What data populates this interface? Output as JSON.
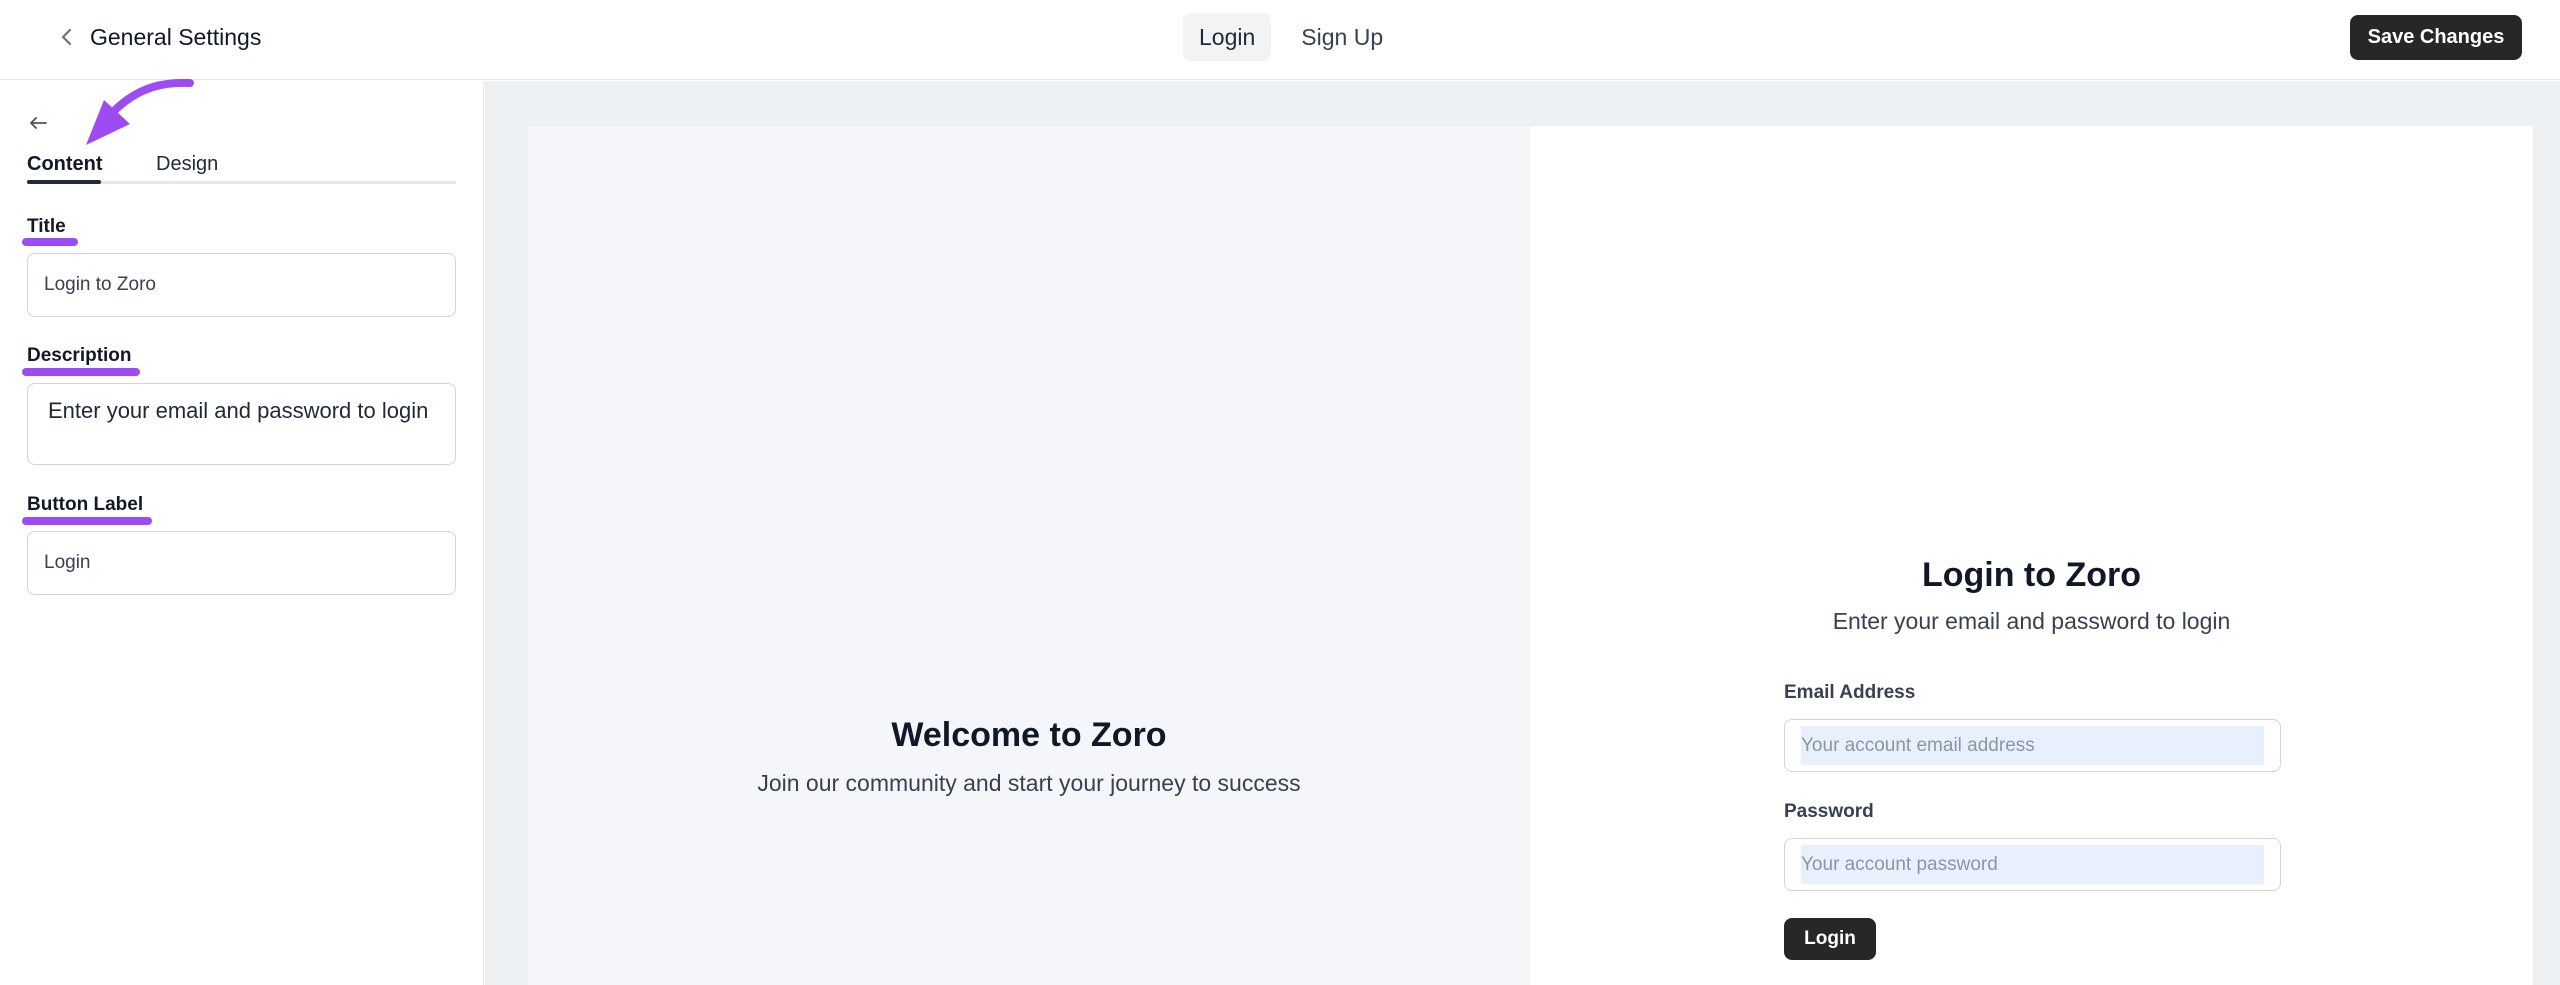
{
  "header": {
    "title": "General Settings",
    "mode_tabs": [
      {
        "label": "Login",
        "active": true
      },
      {
        "label": "Sign Up",
        "active": false
      }
    ],
    "save_label": "Save Changes"
  },
  "sidebar": {
    "tabs": [
      {
        "label": "Content",
        "active": true
      },
      {
        "label": "Design",
        "active": false
      }
    ],
    "fields": {
      "title": {
        "label": "Title",
        "value": "Login to Zoro"
      },
      "description": {
        "label": "Description",
        "value": "Enter your email and password to login"
      },
      "button_label": {
        "label": "Button Label",
        "value": "Login"
      }
    }
  },
  "preview": {
    "welcome_title": "Welcome to Zoro",
    "welcome_subtitle": "Join our community and start your journey to success",
    "login_title": "Login to Zoro",
    "login_description": "Enter your email and password to login",
    "email_label": "Email Address",
    "email_placeholder": "Your account email address",
    "password_label": "Password",
    "password_placeholder": "Your account password",
    "login_button": "Login"
  },
  "colors": {
    "accent_highlight": "#9d4cf4",
    "primary_button": "#27272a"
  }
}
